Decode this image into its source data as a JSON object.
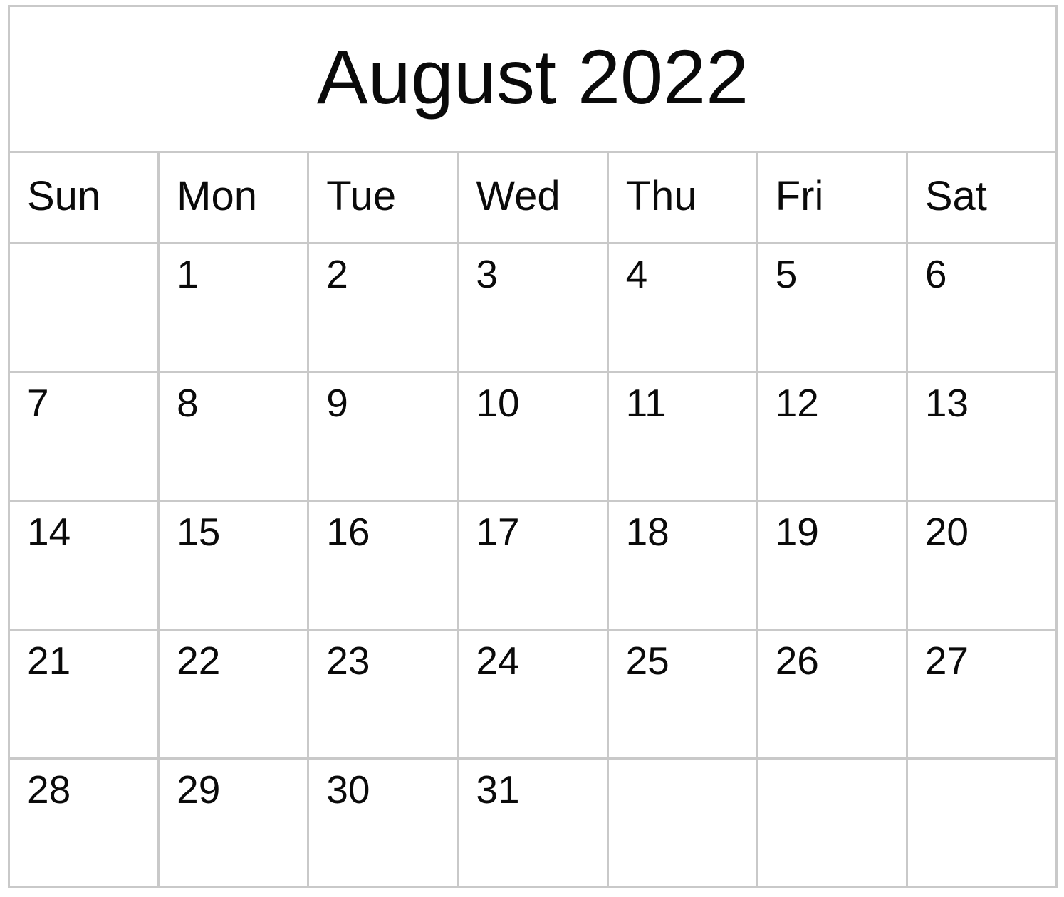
{
  "header": {
    "title": "August 2022"
  },
  "weekdays": [
    {
      "label": "Sun"
    },
    {
      "label": "Mon"
    },
    {
      "label": "Tue"
    },
    {
      "label": "Wed"
    },
    {
      "label": "Thu"
    },
    {
      "label": "Fri"
    },
    {
      "label": "Sat"
    }
  ],
  "weeks": [
    {
      "days": [
        {
          "date": ""
        },
        {
          "date": "1"
        },
        {
          "date": "2"
        },
        {
          "date": "3"
        },
        {
          "date": "4"
        },
        {
          "date": "5"
        },
        {
          "date": "6"
        }
      ]
    },
    {
      "days": [
        {
          "date": "7"
        },
        {
          "date": "8"
        },
        {
          "date": "9"
        },
        {
          "date": "10"
        },
        {
          "date": "11"
        },
        {
          "date": "12"
        },
        {
          "date": "13"
        }
      ]
    },
    {
      "days": [
        {
          "date": "14"
        },
        {
          "date": "15"
        },
        {
          "date": "16"
        },
        {
          "date": "17"
        },
        {
          "date": "18"
        },
        {
          "date": "19"
        },
        {
          "date": "20"
        }
      ]
    },
    {
      "days": [
        {
          "date": "21"
        },
        {
          "date": "22"
        },
        {
          "date": "23"
        },
        {
          "date": "24"
        },
        {
          "date": "25"
        },
        {
          "date": "26"
        },
        {
          "date": "27"
        }
      ]
    },
    {
      "days": [
        {
          "date": "28"
        },
        {
          "date": "29"
        },
        {
          "date": "30"
        },
        {
          "date": "31"
        },
        {
          "date": ""
        },
        {
          "date": ""
        },
        {
          "date": ""
        }
      ]
    }
  ],
  "colors": {
    "grid_line": "#c9c9c9",
    "text": "#0a0a0a",
    "background": "#ffffff"
  }
}
